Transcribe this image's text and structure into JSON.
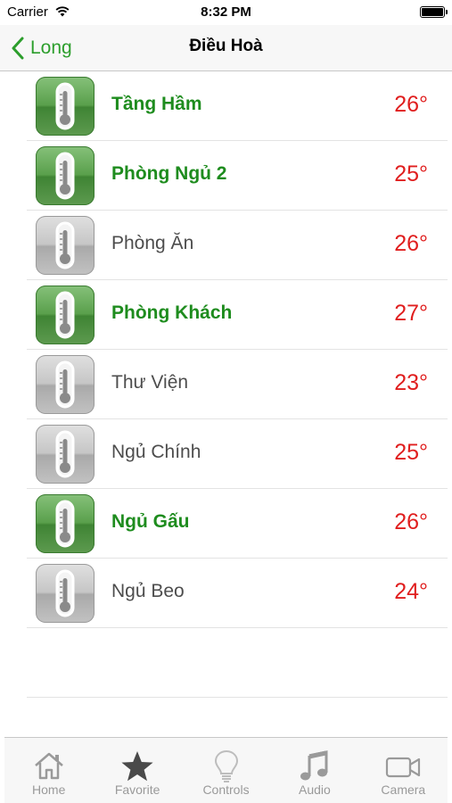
{
  "status_bar": {
    "carrier": "Carrier",
    "time": "8:32 PM"
  },
  "nav": {
    "back_label": "Long",
    "title": "Điều Hoà"
  },
  "colors": {
    "accent": "#2c9e2c",
    "active_text": "#1e8c1e",
    "temperature": "#e01e1e",
    "inactive_text": "#4d4d4d"
  },
  "rooms": [
    {
      "name": "Tầng Hầm",
      "temp": "26°",
      "active": true
    },
    {
      "name": "Phòng Ngủ 2",
      "temp": "25°",
      "active": true
    },
    {
      "name": "Phòng Ăn",
      "temp": "26°",
      "active": false
    },
    {
      "name": "Phòng Khách",
      "temp": "27°",
      "active": true
    },
    {
      "name": "Thư Viện",
      "temp": "23°",
      "active": false
    },
    {
      "name": "Ngủ Chính",
      "temp": "25°",
      "active": false
    },
    {
      "name": "Ngủ Gấu",
      "temp": "26°",
      "active": true
    },
    {
      "name": "Ngủ Beo",
      "temp": "24°",
      "active": false
    }
  ],
  "tabs": [
    {
      "label": "Home",
      "icon": "home-icon"
    },
    {
      "label": "Favorite",
      "icon": "star-icon"
    },
    {
      "label": "Controls",
      "icon": "lightbulb-icon"
    },
    {
      "label": "Audio",
      "icon": "music-note-icon"
    },
    {
      "label": "Camera",
      "icon": "video-camera-icon"
    }
  ]
}
